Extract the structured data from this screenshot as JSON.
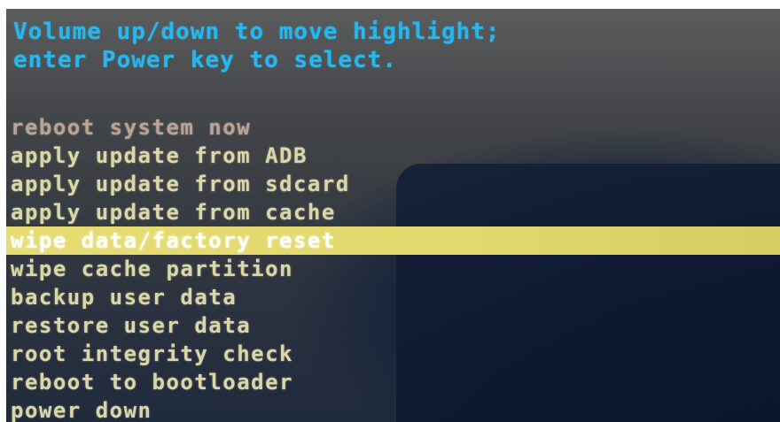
{
  "header": {
    "line1": "Volume up/down to move highlight;",
    "line2": "enter Power key to select."
  },
  "menu": {
    "items": [
      {
        "label": "reboot system now"
      },
      {
        "label": "apply update from ADB"
      },
      {
        "label": "apply update from sdcard"
      },
      {
        "label": "apply update from cache"
      },
      {
        "label": "wipe data/factory reset"
      },
      {
        "label": "wipe cache partition"
      },
      {
        "label": "backup user data"
      },
      {
        "label": "restore user data"
      },
      {
        "label": "root integrity check"
      },
      {
        "label": "reboot to bootloader"
      },
      {
        "label": "power down"
      }
    ],
    "selected_label": "wipe data/factory reset"
  },
  "colors": {
    "header_text": "#27b6ee",
    "menu_text": "#d9d6a8",
    "highlight_bar": "#e6dc72",
    "highlight_text": "#ffffff"
  }
}
